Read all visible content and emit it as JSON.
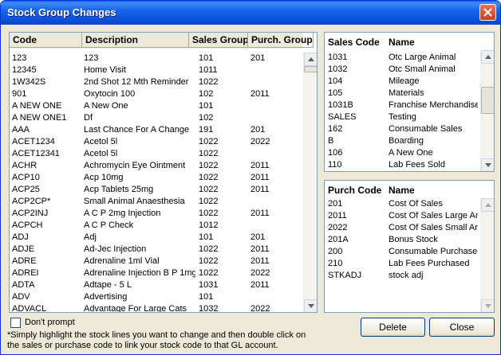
{
  "window": {
    "title": "Stock Group Changes"
  },
  "stock_table": {
    "columns": [
      "Code",
      "Description",
      "Sales Group",
      "Purch. Group"
    ],
    "rows": [
      [
        "123",
        "123",
        "101",
        "201"
      ],
      [
        "12345",
        "Home Visit",
        "1011",
        ""
      ],
      [
        "1W342S",
        "2nd Shot 12 Mth Reminder",
        "1022",
        ""
      ],
      [
        "901",
        "Oxytocin 100",
        "102",
        "2011"
      ],
      [
        "A NEW ONE",
        "A New One",
        "101",
        ""
      ],
      [
        "A NEW ONE1",
        "Df",
        "102",
        ""
      ],
      [
        "AAA",
        "Last Chance For A Change",
        "191",
        "201"
      ],
      [
        "ACET1234",
        "Acetol 5l",
        "1022",
        "2022"
      ],
      [
        "ACET12341",
        "Acetol 5l",
        "1022",
        ""
      ],
      [
        "ACHR",
        "Achromycin Eye Ointment",
        "1022",
        "2011"
      ],
      [
        "ACP10",
        "Acp 10mg",
        "1022",
        "2011"
      ],
      [
        "ACP25",
        "Acp Tablets 25mg",
        "1022",
        "2011"
      ],
      [
        "ACP2CP*",
        "Small Animal Anaesthesia",
        "1022",
        ""
      ],
      [
        "ACP2INJ",
        "A C P 2mg Injection",
        "1022",
        "2011"
      ],
      [
        "ACPCH",
        "A C P Check",
        "1012",
        ""
      ],
      [
        "ADJ",
        "Adj",
        "101",
        "201"
      ],
      [
        "ADJE",
        "Ad-Jec Injection",
        "1022",
        "2011"
      ],
      [
        "ADRE",
        "Adrenaline 1ml Vial",
        "1022",
        "2011"
      ],
      [
        "ADREI",
        "Adrenaline Injection B P 1mg",
        "1022",
        "2022"
      ],
      [
        "ADTA",
        "Adtape - 5 L",
        "1031",
        "2011"
      ],
      [
        "ADV",
        "Advertising",
        "101",
        ""
      ],
      [
        "ADVACL",
        "Advantage For Large Cats",
        "1032",
        "2022"
      ]
    ]
  },
  "sales_table": {
    "columns": [
      "Sales Code",
      "Name"
    ],
    "rows": [
      [
        "1031",
        "Otc Large Animal"
      ],
      [
        "1032",
        "Otc Small Animal"
      ],
      [
        "104",
        "Mileage"
      ],
      [
        "105",
        "Materials"
      ],
      [
        "1031B",
        "Franchise Merchandise"
      ],
      [
        "SALES",
        "Testing"
      ],
      [
        "162",
        "Consumable Sales"
      ],
      [
        "B",
        "Boarding"
      ],
      [
        "106",
        "A New One"
      ],
      [
        "110",
        "Lab Fees Sold"
      ]
    ]
  },
  "purch_table": {
    "columns": [
      "Purch Code",
      "Name"
    ],
    "rows": [
      [
        "201",
        "Cost Of Sales"
      ],
      [
        "2011",
        "Cost Of Sales Large An"
      ],
      [
        "2022",
        "Cost Of Sales Small An"
      ],
      [
        "201A",
        "Bonus Stock"
      ],
      [
        "200",
        "Consumable Purchase"
      ],
      [
        "210",
        "Lab Fees Purchased"
      ],
      [
        "STKADJ",
        "stock adj"
      ]
    ]
  },
  "dont_prompt_label": "Don't prompt",
  "note": "*Simply highlight the stock lines you want to change and then double click on the sales or purchase code to link your stock code to that GL account.",
  "buttons": {
    "delete": "Delete",
    "close": "Close"
  }
}
